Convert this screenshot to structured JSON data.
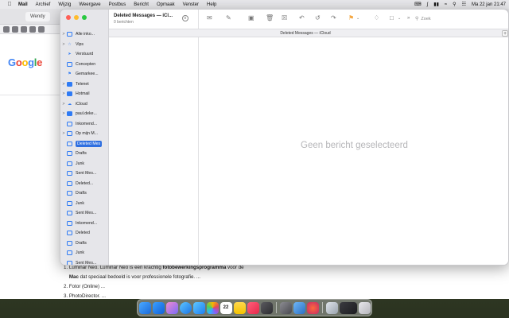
{
  "menubar": {
    "app_name": "Mail",
    "menus": [
      "Archief",
      "Wijzig",
      "Weergave",
      "Postbus",
      "Bericht",
      "Opmaak",
      "Venster",
      "Help"
    ],
    "datetime": "Ma 22 jan  21:47"
  },
  "browser": {
    "tab_label": "Wendy",
    "tab_label2": "M",
    "google_letters": [
      "G",
      "o",
      "o",
      "g",
      "l",
      "e"
    ],
    "results": {
      "item1_prefix": "1.  Luminar Neo. Luminar Neo is een krachtig ",
      "item1_bold": "fotobewerkingsprogramma",
      "item1_suffix": " voor de",
      "item1_line2_bold": "Mac",
      "item1_line2": " dat speciaal bedoeld is voor professionele fotografie. ...",
      "item2": "2.  Fotor (Online) ...",
      "item3": "3.  PhotoDirector. ..."
    }
  },
  "mail": {
    "window_title": "Deleted Messages — iCl...",
    "message_count": "0 berichten",
    "tab_name": "Deleted Messages — iCloud",
    "empty_state": "Geen bericht geselecteerd",
    "search_placeholder": "Zoek",
    "mailboxes": [
      {
        "label": "Alle inko...",
        "chevron": ">",
        "icon": "inbox-stack-icon"
      },
      {
        "label": "Vips",
        "chevron": ">",
        "icon": "star-icon"
      },
      {
        "label": "Verstuurd",
        "chevron": "",
        "icon": "paperplane-icon"
      },
      {
        "label": "Concepten",
        "chevron": "",
        "icon": "document-icon"
      },
      {
        "label": "Gemarkee...",
        "chevron": "",
        "icon": "flag-icon"
      },
      {
        "label": "Telenet",
        "chevron": ">",
        "icon": "account-icon"
      },
      {
        "label": "Hotmail",
        "chevron": ">",
        "icon": "account-icon"
      },
      {
        "label": "iCloud",
        "chevron": ">",
        "icon": "cloud-icon"
      },
      {
        "label": "paul.deke...",
        "chevron": ">",
        "icon": "account-icon"
      },
      {
        "label": "Inkomend...",
        "chevron": "",
        "icon": "inbox-icon"
      },
      {
        "label": "Op mijn M...",
        "chevron": ">",
        "icon": "computer-icon"
      },
      {
        "label": "Deleted Mes",
        "chevron": "",
        "icon": "folder-icon",
        "selected": true
      },
      {
        "label": "Drafts",
        "chevron": "",
        "icon": "folder-icon"
      },
      {
        "label": "Junk",
        "chevron": "",
        "icon": "folder-icon"
      },
      {
        "label": "Sent Mes...",
        "chevron": "",
        "icon": "folder-icon"
      },
      {
        "label": "Deleted...",
        "chevron": "",
        "icon": "folder-icon"
      },
      {
        "label": "Drafts",
        "chevron": "",
        "icon": "folder-icon"
      },
      {
        "label": "Junk",
        "chevron": "",
        "icon": "folder-icon"
      },
      {
        "label": "Sent Mes...",
        "chevron": "",
        "icon": "folder-icon"
      },
      {
        "label": "Inkomend...",
        "chevron": "",
        "icon": "inbox-icon"
      },
      {
        "label": "Deleted",
        "chevron": "",
        "icon": "folder-icon"
      },
      {
        "label": "Drafts",
        "chevron": "",
        "icon": "folder-icon"
      },
      {
        "label": "Junk",
        "chevron": "",
        "icon": "folder-icon"
      },
      {
        "label": "Sent Mes...",
        "chevron": "",
        "icon": "folder-icon"
      }
    ]
  },
  "dock": {
    "calendar_day": "22"
  },
  "colors": {
    "accent": "#2f6fe0",
    "traffic_red": "#ff5f57",
    "traffic_yellow": "#febc2e",
    "traffic_green": "#28c840"
  }
}
